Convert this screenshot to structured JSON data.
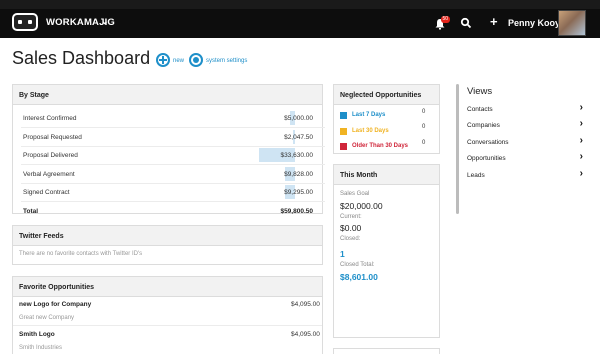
{
  "topbar": {
    "brand": "WORKAMAJIG",
    "notification_count": "50",
    "user_name": "Penny Kooy"
  },
  "header": {
    "title": "Sales Dashboard",
    "new_label": "new",
    "settings_label": "system settings"
  },
  "by_stage": {
    "title": "By Stage",
    "rows": [
      {
        "label": "Interest Confirmed",
        "value": "$5,000.00",
        "share": 0.15
      },
      {
        "label": "Proposal Requested",
        "value": "$2,047.50",
        "share": 0.06
      },
      {
        "label": "Proposal Delivered",
        "value": "$33,630.00",
        "share": 1.0
      },
      {
        "label": "Verbal Agreement",
        "value": "$9,828.00",
        "share": 0.29
      },
      {
        "label": "Signed Contract",
        "value": "$9,295.00",
        "share": 0.28
      }
    ],
    "total_label": "Total",
    "total_value": "$59,800.50"
  },
  "twitter": {
    "title": "Twitter Feeds",
    "empty_text": "There are no favorite contacts with Twitter ID's"
  },
  "favorites": {
    "title": "Favorite Opportunities",
    "items": [
      {
        "name": "new Logo for Company",
        "value": "$4,095.00",
        "company": "Great new Company"
      },
      {
        "name": "Smith Logo",
        "value": "$4,095.00",
        "company": "Smith Industries"
      }
    ]
  },
  "neglected": {
    "title": "Neglected Opportunities",
    "rows": [
      {
        "label": "Last 7 Days",
        "count": "0",
        "color": "#1e8fc9"
      },
      {
        "label": "Last 30 Days",
        "count": "0",
        "color": "#f0b323"
      },
      {
        "label": "Older Than 30 Days",
        "count": "0",
        "color": "#d0263a"
      }
    ]
  },
  "this_month": {
    "title": "This Month",
    "sales_goal_label": "Sales Goal",
    "sales_goal_value": "$20,000.00",
    "current_label": "Current:",
    "current_value": "$0.00",
    "closed_label": "Closed:",
    "closed_value": "1",
    "closed_total_label": "Closed Total:",
    "closed_total_value": "$8,601.00"
  },
  "views": {
    "title": "Views",
    "items": [
      "Contacts",
      "Companies",
      "Conversations",
      "Opportunities",
      "Leads"
    ]
  },
  "colors": {
    "accent": "#1e8fc9",
    "topbar": "#0d0d0d",
    "badge": "#e2231a"
  }
}
